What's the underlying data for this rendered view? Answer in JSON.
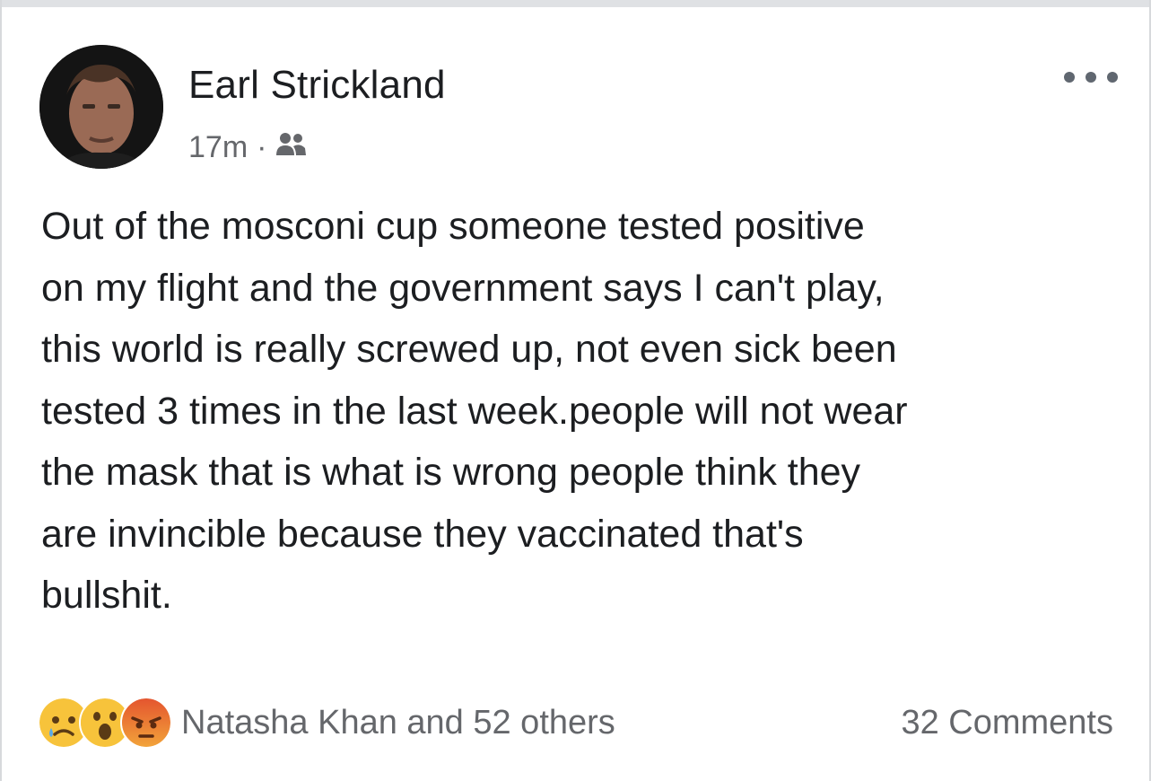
{
  "post": {
    "author": "Earl Strickland",
    "time": "17m",
    "separator": "·",
    "audience_icon": "friends-icon",
    "more_icon": "more-options-icon",
    "lines": [
      "Out of the mosconi cup someone tested positive",
      "on my flight and the  government says I can't play,",
      "this world is really screwed up, not even sick been",
      "tested 3 times in the last week.people will not wear",
      "the mask that is what is wrong people think they",
      "are invincible because they vaccinated that's",
      "bullshit."
    ]
  },
  "reactions": {
    "icons": [
      "sad-reaction-icon",
      "wow-reaction-icon",
      "angry-reaction-icon"
    ],
    "summary": "Natasha Khan and 52 others"
  },
  "comments": {
    "label": "32 Comments"
  },
  "colors": {
    "text": "#1c1e21",
    "secondary": "#65676b",
    "sad": "#f7c33b",
    "wow": "#f7c33b",
    "angry": "#e4552f"
  }
}
